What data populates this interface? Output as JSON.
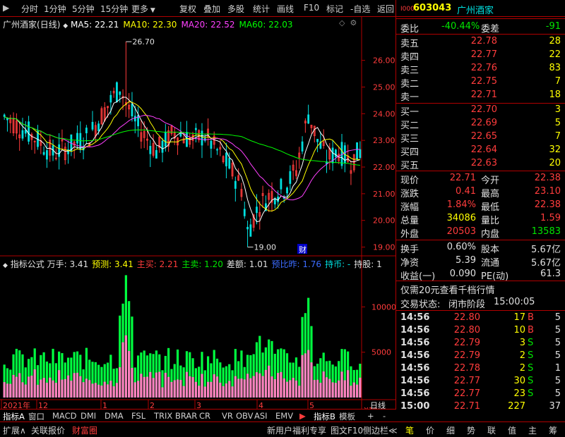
{
  "toolbar": {
    "left_items": [
      "分时",
      "1分钟",
      "5分钟",
      "15分钟",
      "更多"
    ],
    "right_items": [
      "复权",
      "叠加",
      "多股",
      "统计",
      "画线",
      "F10",
      "标记",
      "-自选",
      "返回"
    ]
  },
  "stock": {
    "name": "广州酒家",
    "code": "603043",
    "period": "(日线)"
  },
  "ma_legend": [
    {
      "label": "MA5: 22.21",
      "color": "#ffffff"
    },
    {
      "label": "MA10: 22.30",
      "color": "#ffff00"
    },
    {
      "label": "MA20: 22.52",
      "color": "#ff40ff"
    },
    {
      "label": "MA60: 22.03",
      "color": "#00ff00"
    }
  ],
  "price_axis": {
    "ticks": [
      "26.00",
      "25.00",
      "24.00",
      "23.00",
      "22.00",
      "21.00",
      "20.00",
      "19.00"
    ]
  },
  "annotations": {
    "high": "26.70",
    "low": "19.00",
    "fin_marker": "财"
  },
  "indicator": {
    "name": "指标公式",
    "items": [
      {
        "label": "万手: 3.41",
        "color": "#e0e0e0"
      },
      {
        "label": "预测: 3.41",
        "color": "#ffff00"
      },
      {
        "label": "主买: 2.21",
        "color": "#ff3c3c"
      },
      {
        "label": "主卖: 1.20",
        "color": "#00e600"
      },
      {
        "label": "差额: 1.01",
        "color": "#e0e0e0"
      },
      {
        "label": "预比昨: 1.76",
        "color": "#3c6cff"
      },
      {
        "label": "持币: -",
        "color": "#00e0e0"
      },
      {
        "label": "持股: 1",
        "color": "#e0e0e0"
      }
    ],
    "axis_ticks": [
      "10000",
      "5000"
    ],
    "multiplier": "X10"
  },
  "date_axis": {
    "labels": [
      "2021年",
      "12",
      "1",
      "2",
      "3",
      "4",
      "5"
    ],
    "period_label": "日线"
  },
  "bottom_tabs": [
    "指标A",
    "窗口",
    "MACD",
    "DMI",
    "DMA",
    "FSL",
    "TRIX",
    "BRAR",
    "CR",
    "VR",
    "OBV",
    "ASI",
    "EMV",
    "指标B",
    "模板",
    "+",
    "-"
  ],
  "statusbar": {
    "left": [
      "扩展∧",
      "关联报价",
      "财富圈"
    ],
    "right": [
      "新用户福利专享",
      "图文F10",
      "侧边栏≪"
    ],
    "quote_tabs": [
      "笔",
      "价",
      "细",
      "势",
      "联",
      "值",
      "主",
      "筹"
    ]
  },
  "quote": {
    "header_code": "603043",
    "header_name": "广州酒家",
    "weibi_label": "委比",
    "weibi": "-40.44%",
    "weicha_label": "委差",
    "weicha": "-91",
    "sell": [
      {
        "label": "卖五",
        "price": "22.78",
        "vol": "28"
      },
      {
        "label": "卖四",
        "price": "22.77",
        "vol": "22"
      },
      {
        "label": "卖三",
        "price": "22.76",
        "vol": "83"
      },
      {
        "label": "卖二",
        "price": "22.75",
        "vol": "7"
      },
      {
        "label": "卖一",
        "price": "22.71",
        "vol": "18"
      }
    ],
    "buy": [
      {
        "label": "买一",
        "price": "22.70",
        "vol": "3"
      },
      {
        "label": "买二",
        "price": "22.69",
        "vol": "5"
      },
      {
        "label": "买三",
        "price": "22.65",
        "vol": "7"
      },
      {
        "label": "买四",
        "price": "22.64",
        "vol": "32"
      },
      {
        "label": "买五",
        "price": "22.63",
        "vol": "20"
      }
    ],
    "stats": [
      {
        "l1": "现价",
        "v1": "22.71",
        "c1": "red",
        "l2": "今开",
        "v2": "22.38",
        "c2": "red"
      },
      {
        "l1": "涨跌",
        "v1": "0.41",
        "c1": "red",
        "l2": "最高",
        "v2": "23.10",
        "c2": "red"
      },
      {
        "l1": "涨幅",
        "v1": "1.84%",
        "c1": "red",
        "l2": "最低",
        "v2": "22.38",
        "c2": "red"
      },
      {
        "l1": "总量",
        "v1": "34086",
        "c1": "yellow",
        "l2": "量比",
        "v2": "1.59",
        "c2": "red"
      },
      {
        "l1": "外盘",
        "v1": "20503",
        "c1": "red",
        "l2": "内盘",
        "v2": "13583",
        "c2": "green"
      }
    ],
    "fund": [
      {
        "l1": "换手",
        "v1": "0.60%",
        "l2": "股本",
        "v2": "5.67亿"
      },
      {
        "l1": "净资",
        "v1": "5.39",
        "l2": "流通",
        "v2": "5.67亿"
      },
      {
        "l1": "收益(一)",
        "v1": "0.090",
        "l2": "PE(动)",
        "v2": "61.3"
      }
    ],
    "promo": "仅需20元查看千档行情",
    "trade_status_label": "交易状态:",
    "trade_status": "闭市阶段",
    "trade_time": "15:00:05",
    "ticks": [
      {
        "time": "14:56",
        "price": "22.80",
        "vol": "17",
        "bs": "B",
        "n": "5"
      },
      {
        "time": "14:56",
        "price": "22.80",
        "vol": "10",
        "bs": "B",
        "n": "5"
      },
      {
        "time": "14:56",
        "price": "22.79",
        "vol": "3",
        "bs": "S",
        "n": "5"
      },
      {
        "time": "14:56",
        "price": "22.79",
        "vol": "2",
        "bs": "S",
        "n": "5"
      },
      {
        "time": "14:56",
        "price": "22.78",
        "vol": "2",
        "bs": "S",
        "n": "1"
      },
      {
        "time": "14:56",
        "price": "22.77",
        "vol": "30",
        "bs": "S",
        "n": "5"
      },
      {
        "time": "14:56",
        "price": "22.77",
        "vol": "23",
        "bs": "S",
        "n": "5"
      },
      {
        "time": "15:00",
        "price": "22.71",
        "vol": "227",
        "bs": "",
        "n": "37"
      }
    ]
  },
  "colors": {
    "up": "#ff3c3c",
    "down": "#00e0e0",
    "vol_up": "#ff80c0",
    "vol_down": "#00ff40",
    "border": "#b00000"
  }
}
